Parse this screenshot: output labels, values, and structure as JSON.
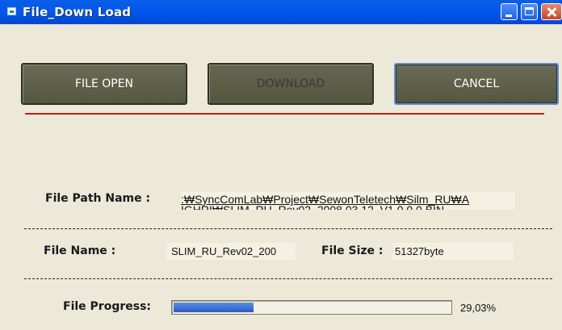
{
  "window": {
    "title": "File_Down Load"
  },
  "buttons": {
    "file_open": "FILE OPEN",
    "download": "DOWNLOAD",
    "cancel": "CANCEL"
  },
  "file_path": {
    "label": "File Path Name :",
    "value_line1": ":₩SyncComLab₩Project₩SewonTeletech₩Silm_RU₩A",
    "value_line2": "IGHRI₩SLIM_RU_Rev02_2008.03.12_V1.0.0.0.BIN"
  },
  "file_name": {
    "label": "File Name :",
    "value": "SLIM_RU_Rev02_200"
  },
  "file_size": {
    "label": "File Size :",
    "value": "51327byte"
  },
  "progress": {
    "label": "File Progress:",
    "percent_text": "29,03%",
    "fraction": 0.2903
  },
  "colors": {
    "titlebar": "#0058ee",
    "button_face": "#5f604a",
    "accent_line": "#c81a1a",
    "progress_fill": "#2a5cc8"
  }
}
